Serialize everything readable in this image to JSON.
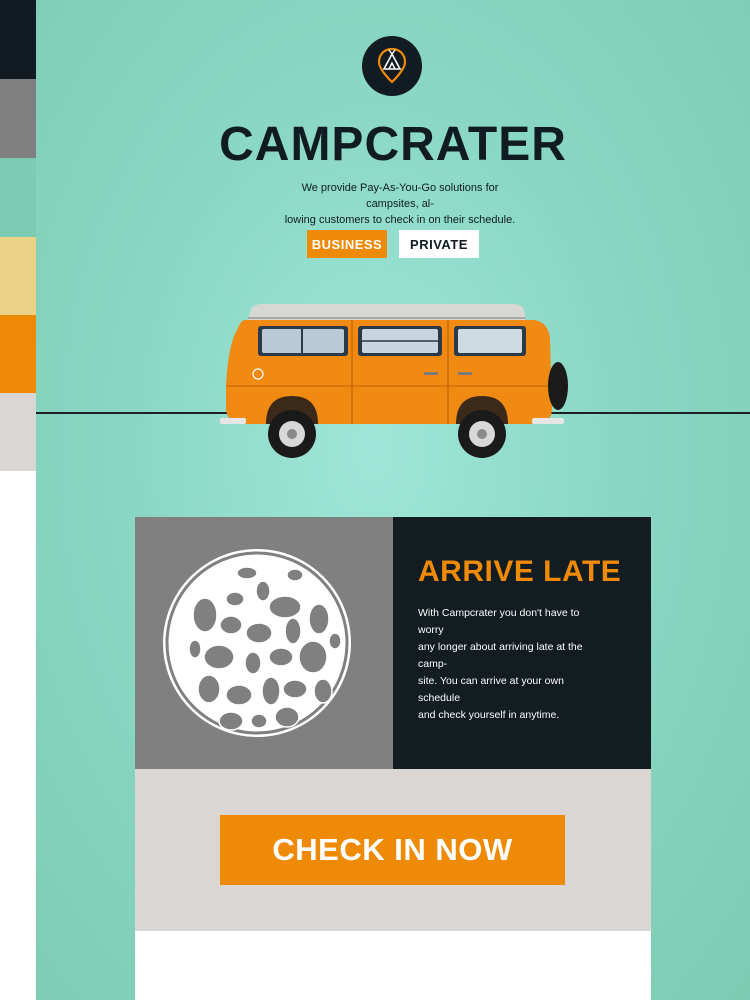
{
  "palette": {
    "swatches": [
      "#111b21",
      "#808080",
      "#7ccbb2",
      "#ebd287",
      "#ef8a07",
      "#d9d6d3",
      "#ffffff"
    ]
  },
  "header": {
    "logo_icon": "tent-pin-icon",
    "brand_name": "CAMPCRATER",
    "tagline_line1": "We provide Pay-As-You-Go solutions for campsites, al-",
    "tagline_line2": "lowing customers to check in on their schedule.",
    "toggle": {
      "business_label": "BUSINESS",
      "private_label": "PRIVATE",
      "selected": "BUSINESS"
    }
  },
  "hero": {
    "image": "orange-camper-van",
    "accent_color": "#ef8a07"
  },
  "feature": {
    "illustration": "moon-icon",
    "heading": "ARRIVE LATE",
    "body_line1": "With Campcrater you don't have to worry",
    "body_line2": "any longer about arriving late at the camp-",
    "body_line3": "site. You can arrive at your own schedule",
    "body_line4": "and check yourself in anytime."
  },
  "cta": {
    "label": "CHECK IN NOW"
  }
}
